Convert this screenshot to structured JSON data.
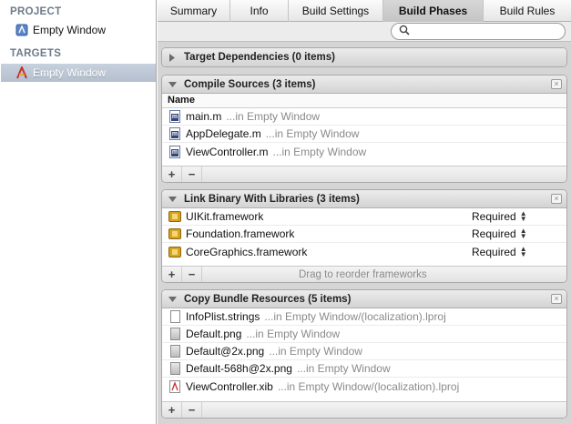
{
  "sidebar": {
    "project_header": "PROJECT",
    "project_item": "Empty Window",
    "targets_header": "TARGETS",
    "target_item": "Empty Window"
  },
  "tabs": [
    "Summary",
    "Info",
    "Build Settings",
    "Build Phases",
    "Build Rules"
  ],
  "active_tab": "Build Phases",
  "search": {
    "placeholder": ""
  },
  "sections": {
    "target_dependencies": {
      "title": "Target Dependencies (0 items)"
    },
    "compile_sources": {
      "title": "Compile Sources (3 items)",
      "column": "Name",
      "rows": [
        {
          "name": "main.m",
          "location": "...in Empty Window"
        },
        {
          "name": "AppDelegate.m",
          "location": "...in Empty Window"
        },
        {
          "name": "ViewController.m",
          "location": "...in Empty Window"
        }
      ]
    },
    "link_binary": {
      "title": "Link Binary With Libraries (3 items)",
      "rows": [
        {
          "name": "UIKit.framework",
          "status": "Required"
        },
        {
          "name": "Foundation.framework",
          "status": "Required"
        },
        {
          "name": "CoreGraphics.framework",
          "status": "Required"
        }
      ],
      "footer_hint": "Drag to reorder frameworks"
    },
    "copy_bundle": {
      "title": "Copy Bundle Resources (5 items)",
      "rows": [
        {
          "name": "InfoPlist.strings",
          "location": "...in Empty Window/(localization).lproj"
        },
        {
          "name": "Default.png",
          "location": "...in Empty Window"
        },
        {
          "name": "Default@2x.png",
          "location": "...in Empty Window"
        },
        {
          "name": "Default-568h@2x.png",
          "location": "...in Empty Window"
        },
        {
          "name": "ViewController.xib",
          "location": "...in Empty Window/(localization).lproj"
        }
      ]
    }
  },
  "buttons": {
    "add": "+",
    "remove": "−",
    "close": "×"
  },
  "colors": {
    "selection": "#b9c3d1",
    "header_text": "#6c7a8a",
    "muted_text": "#8a8a8a"
  }
}
